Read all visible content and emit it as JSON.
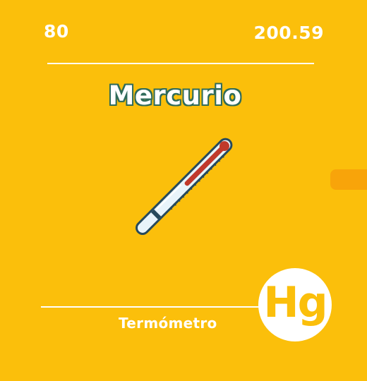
{
  "element": {
    "atomic_number": "80",
    "atomic_mass": "200.59",
    "name": "Mercurio",
    "symbol": "Hg",
    "use": "Termómetro"
  },
  "illustration": {
    "icon": "thermometer-icon"
  },
  "colors": {
    "background": "#FBBF0B",
    "text": "#FFFFFF",
    "title_outline": "#2F6B5A",
    "side_tab": "#F8A40A",
    "mercury": "#C0392B"
  }
}
